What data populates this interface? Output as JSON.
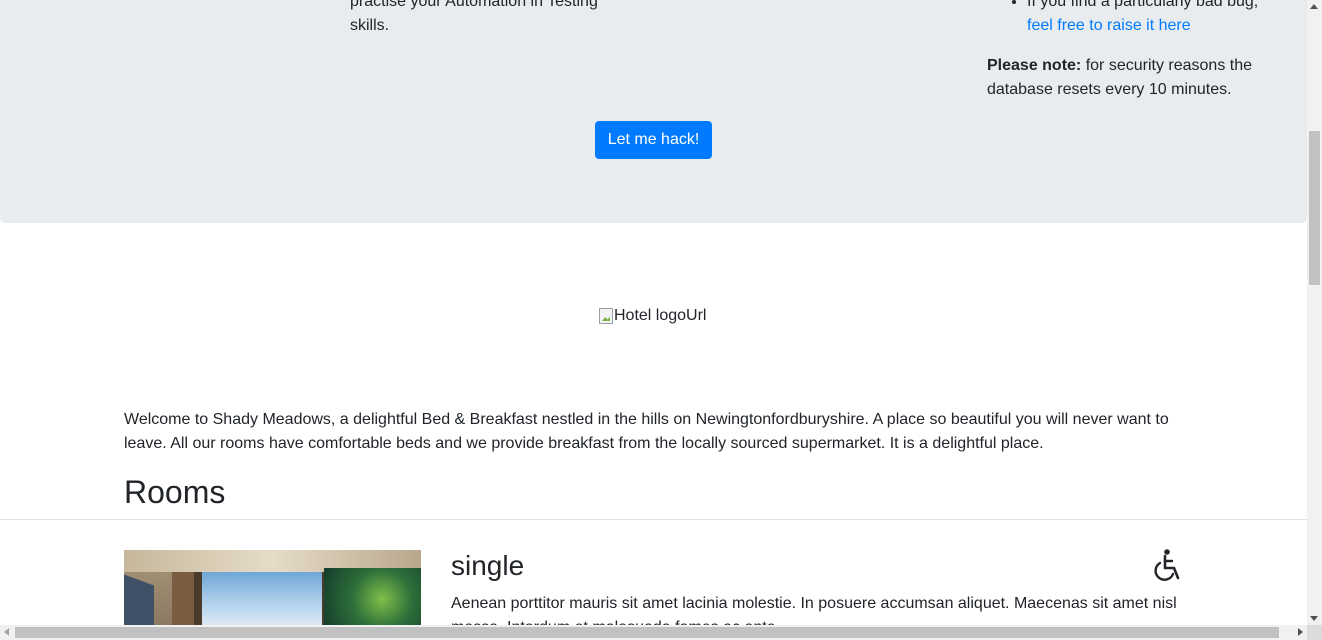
{
  "intro": {
    "left_text_line1": "practise your Automation in Testing",
    "left_text_line2": "skills.",
    "bug_text": "If you find a particularly bad bug,",
    "bug_link": "feel free to raise it here",
    "note_label": "Please note:",
    "note_text": " for security reasons the database resets every 10 minutes."
  },
  "hack_button": "Let me hack!",
  "logo_alt": "Hotel logoUrl",
  "welcome": "Welcome to Shady Meadows, a delightful Bed & Breakfast nestled in the hills on Newingtonfordburyshire. A place so beautiful you will never want to leave. All our rooms have comfortable beds and we provide breakfast from the locally sourced supermarket. It is a delightful place.",
  "rooms": {
    "heading": "Rooms",
    "items": [
      {
        "type": "single",
        "description": "Aenean porttitor mauris sit amet lacinia molestie. In posuere accumsan aliquet. Maecenas sit amet nisl massa. Interdum et malesuada fames ac ante.",
        "features_icon": "wheelchair-accessible-icon"
      }
    ]
  },
  "colors": {
    "primary": "#007bff",
    "jumbotron_bg": "#e9ecef",
    "text": "#212529"
  }
}
